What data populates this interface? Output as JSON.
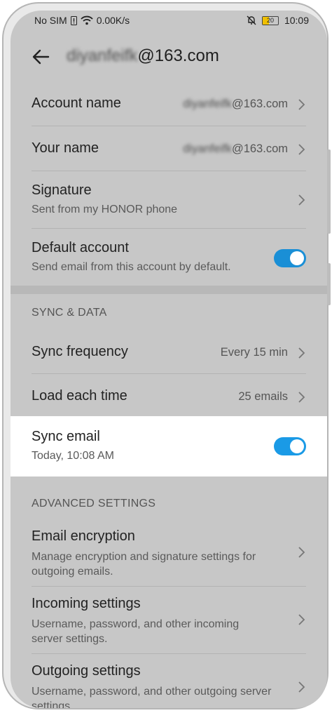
{
  "status_bar": {
    "carrier": "No SIM",
    "speed": "0.00K/s",
    "battery": "20",
    "time": "10:09"
  },
  "header": {
    "account_blurred": "diyanfeifk",
    "account_domain": "@163.com",
    "back_icon": "arrow-left-icon"
  },
  "rows": {
    "account_name": {
      "label": "Account name",
      "value_blurred": "diyanfeifk",
      "value_domain": "@163.com"
    },
    "your_name": {
      "label": "Your name",
      "value_blurred": "diyanfeifk",
      "value_domain": "@163.com"
    },
    "signature": {
      "label": "Signature",
      "sub": "Sent from my HONOR phone"
    },
    "default_account": {
      "label": "Default account",
      "sub": "Send email from this account by default.",
      "enabled": true
    }
  },
  "sync_section": {
    "header": "SYNC & DATA",
    "sync_frequency": {
      "label": "Sync frequency",
      "value": "Every 15 min"
    },
    "load_each_time": {
      "label": "Load each time",
      "value": "25 emails"
    },
    "sync_email": {
      "label": "Sync email",
      "sub": "Today, 10:08 AM",
      "enabled": true
    }
  },
  "advanced_section": {
    "header": "ADVANCED SETTINGS",
    "email_encryption": {
      "label": "Email encryption",
      "sub": "Manage encryption and signature settings for outgoing emails."
    },
    "incoming": {
      "label": "Incoming settings",
      "sub": "Username, password, and other incoming server settings."
    },
    "outgoing": {
      "label": "Outgoing settings",
      "sub": "Username, password, and other outgoing server settings."
    }
  },
  "colors": {
    "accent": "#1a8fd6",
    "dim_background": "#c7c7c7",
    "highlight": "#ffffff"
  }
}
